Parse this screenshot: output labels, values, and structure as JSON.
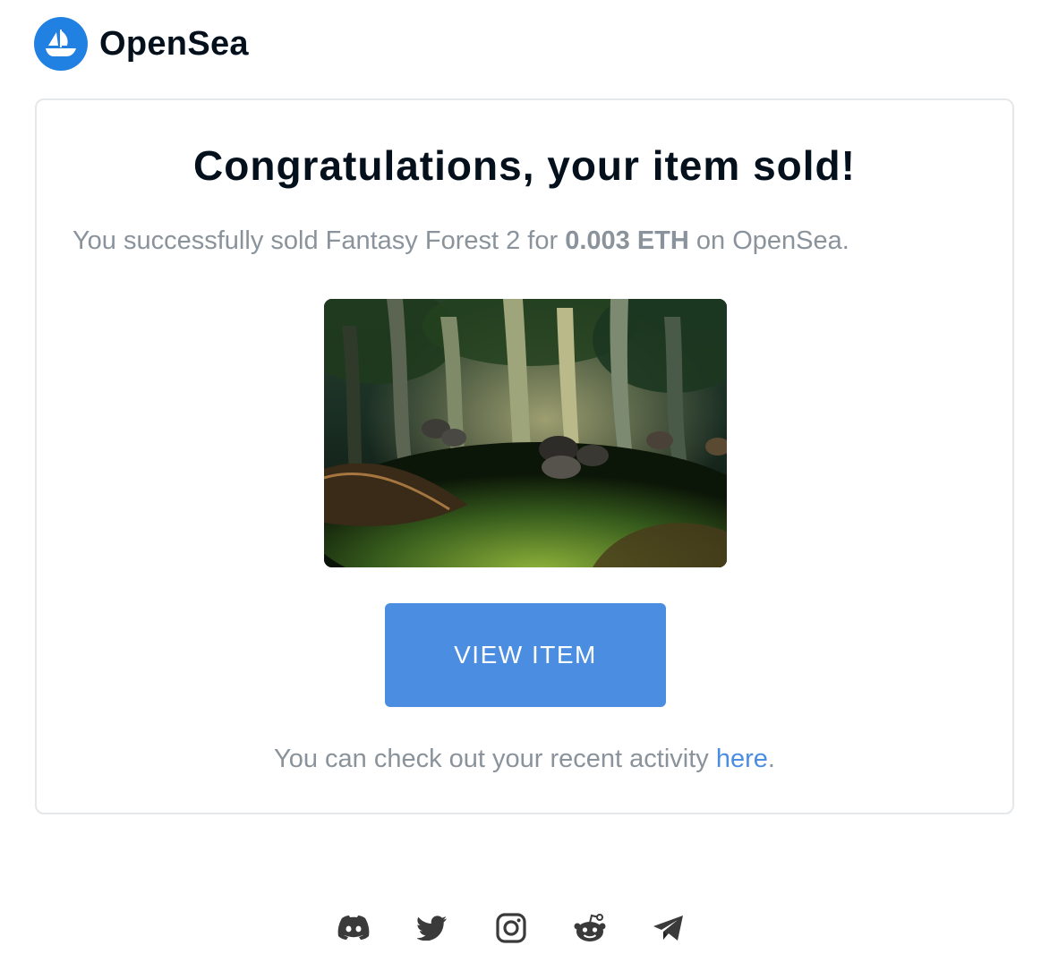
{
  "header": {
    "brand_name": "OpenSea",
    "logo_icon": "opensea-ship-icon",
    "brand_color": "#2081e2"
  },
  "email": {
    "headline": "Congratulations, your item sold!",
    "sale_prefix": "You successfully sold Fantasy Forest 2 for ",
    "sale_price": "0.003 ETH",
    "sale_suffix": " on OpenSea.",
    "item_image_icon": "fantasy-forest-artwork",
    "view_button_label": "VIEW ITEM",
    "activity_prefix": "You can check out your recent activity ",
    "activity_link_label": "here",
    "activity_suffix": "."
  },
  "colors": {
    "accent": "#4a8de1",
    "muted_text": "#8a939b",
    "heading_text": "#04111d",
    "card_border": "#e5e8eb"
  },
  "footer": {
    "social_icons": [
      "discord-icon",
      "twitter-icon",
      "instagram-icon",
      "reddit-icon",
      "telegram-icon"
    ]
  }
}
